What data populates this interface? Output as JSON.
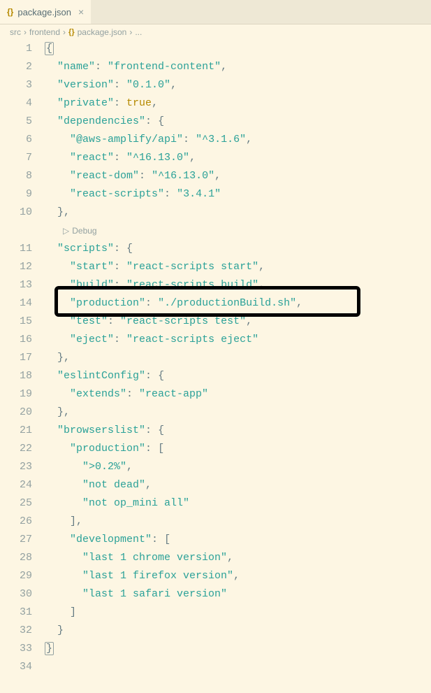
{
  "tab": {
    "icon": "{}",
    "label": "package.json",
    "close": "×"
  },
  "breadcrumbs": {
    "b0": "src",
    "b1": "frontend",
    "icon": "{}",
    "b2": "package.json",
    "b3": "..."
  },
  "debug_label": "Debug",
  "lines": {
    "n1": "1",
    "n2": "2",
    "n3": "3",
    "n4": "4",
    "n5": "5",
    "n6": "6",
    "n7": "7",
    "n8": "8",
    "n9": "9",
    "n10": "10",
    "n11": "11",
    "n12": "12",
    "n13": "13",
    "n14": "14",
    "n15": "15",
    "n16": "16",
    "n17": "17",
    "n18": "18",
    "n19": "19",
    "n20": "20",
    "n21": "21",
    "n22": "22",
    "n23": "23",
    "n24": "24",
    "n25": "25",
    "n26": "26",
    "n27": "27",
    "n28": "28",
    "n29": "29",
    "n30": "30",
    "n31": "31",
    "n32": "32",
    "n33": "33",
    "n34": "34"
  },
  "code": {
    "l1_open": "{",
    "l2_k": "\"name\"",
    "l2_v": "\"frontend-content\"",
    "l3_k": "\"version\"",
    "l3_v": "\"0.1.0\"",
    "l4_k": "\"private\"",
    "l4_v": "true",
    "l5_k": "\"dependencies\"",
    "l6_k": "\"@aws-amplify/api\"",
    "l6_v": "\"^3.1.6\"",
    "l7_k": "\"react\"",
    "l7_v": "\"^16.13.0\"",
    "l8_k": "\"react-dom\"",
    "l8_v": "\"^16.13.0\"",
    "l9_k": "\"react-scripts\"",
    "l9_v": "\"3.4.1\"",
    "l11_k": "\"scripts\"",
    "l12_k": "\"start\"",
    "l12_v": "\"react-scripts start\"",
    "l13_k": "\"build\"",
    "l13_v": "\"react-scripts build\"",
    "l14_k": "\"production\"",
    "l14_v": "\"./productionBuild.sh\"",
    "l15_k": "\"test\"",
    "l15_v": "\"react-scripts test\"",
    "l16_k": "\"eject\"",
    "l16_v": "\"react-scripts eject\"",
    "l18_k": "\"eslintConfig\"",
    "l19_k": "\"extends\"",
    "l19_v": "\"react-app\"",
    "l21_k": "\"browserslist\"",
    "l22_k": "\"production\"",
    "l23_v": "\">0.2%\"",
    "l24_v": "\"not dead\"",
    "l25_v": "\"not op_mini all\"",
    "l27_k": "\"development\"",
    "l28_v": "\"last 1 chrome version\"",
    "l29_v": "\"last 1 firefox version\"",
    "l30_v": "\"last 1 safari version\"",
    "l33_close": "}"
  }
}
